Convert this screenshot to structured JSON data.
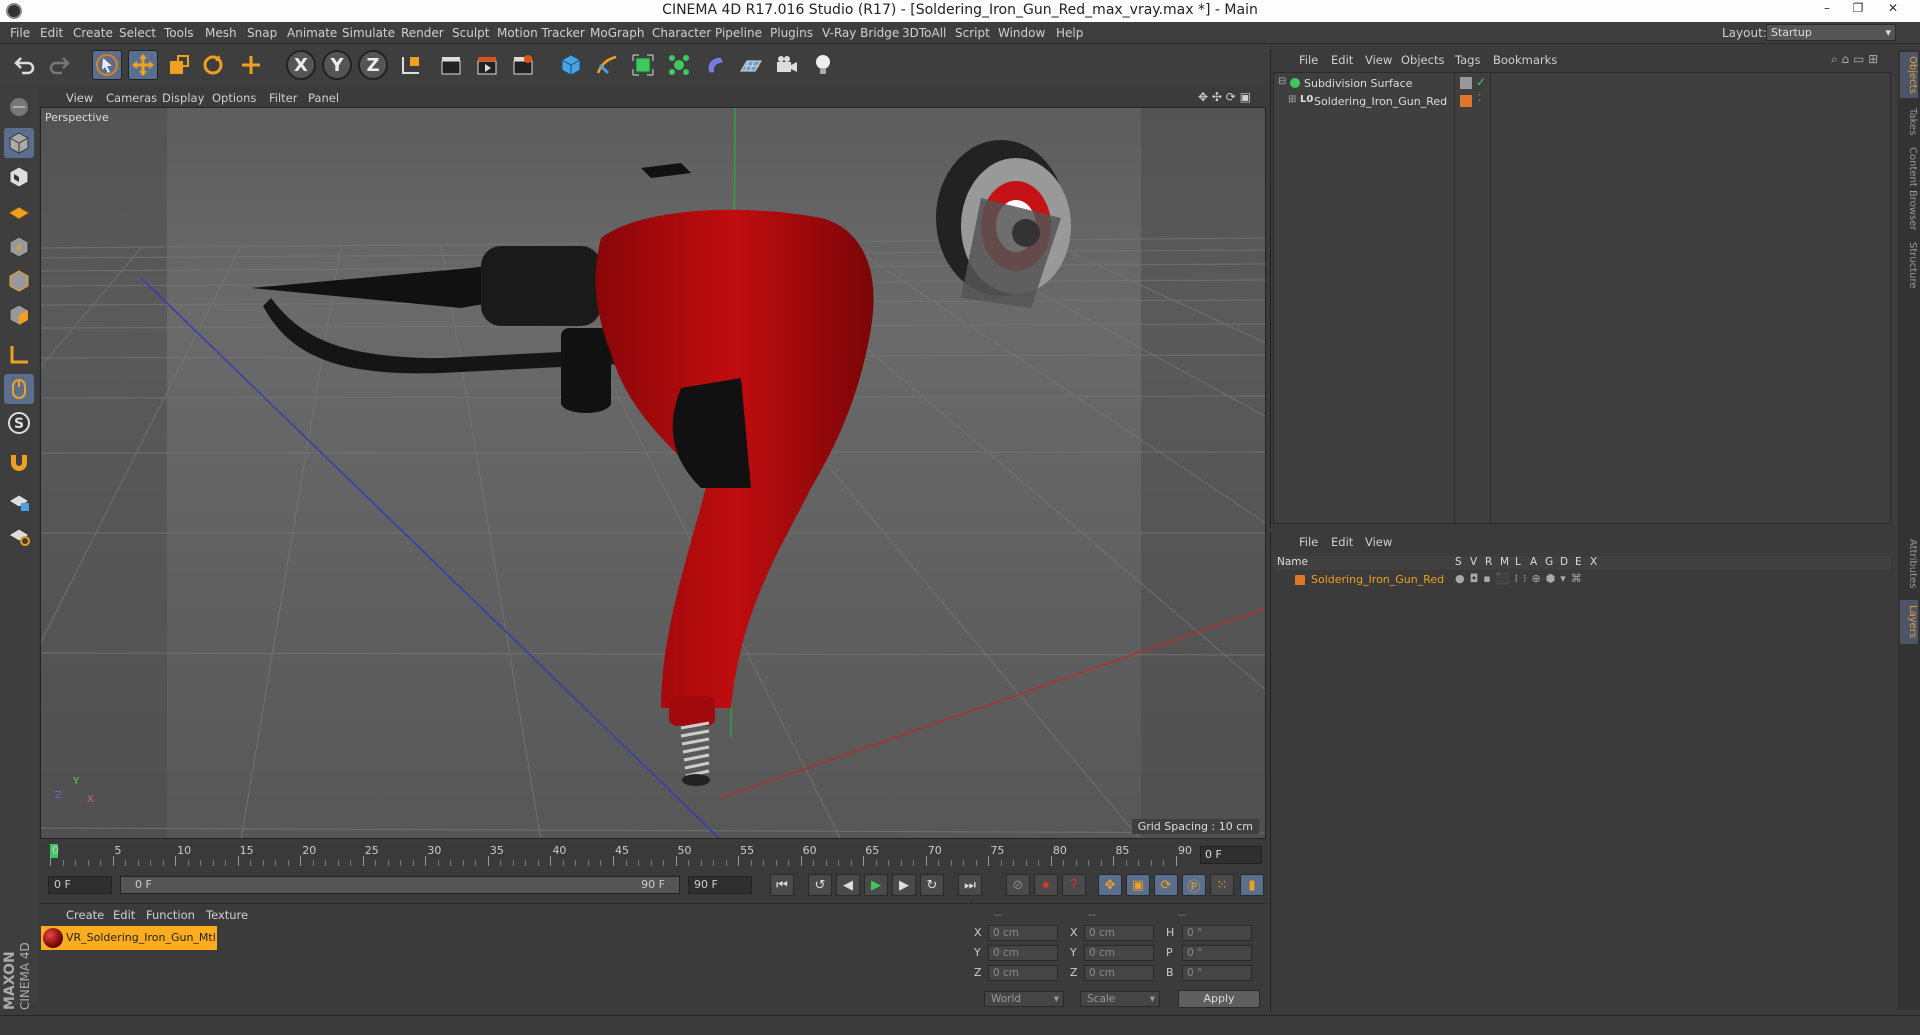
{
  "window": {
    "title": "CINEMA 4D R17.016 Studio (R17) - [Soldering_Iron_Gun_Red_max_vray.max *] - Main",
    "minimize": "–",
    "restore": "❐",
    "close": "✕"
  },
  "menubar": {
    "items": [
      "File",
      "Edit",
      "Create",
      "Select",
      "Tools",
      "Mesh",
      "Snap",
      "Animate",
      "Simulate",
      "Render",
      "Sculpt",
      "Motion Tracker",
      "MoGraph",
      "Character",
      "Pipeline",
      "Plugins",
      "V-Ray Bridge",
      "3DToAll",
      "Script",
      "Window",
      "Help"
    ],
    "layout_label": "Layout:",
    "layout_value": "Startup"
  },
  "toolbar": {
    "axis_x": "X",
    "axis_y": "Y",
    "axis_z": "Z"
  },
  "viewport": {
    "menu": [
      "View",
      "Cameras",
      "Display",
      "Options",
      "Filter",
      "Panel"
    ],
    "label": "Perspective",
    "grid_spacing": "Grid Spacing : 10 cm",
    "axis_y": "Y",
    "axis_x": "X",
    "axis_z": "Z"
  },
  "timeline": {
    "ticks": [
      "0",
      "5",
      "10",
      "15",
      "20",
      "25",
      "30",
      "35",
      "40",
      "45",
      "50",
      "55",
      "60",
      "65",
      "70",
      "75",
      "80",
      "85",
      "90"
    ],
    "frame": "0 F"
  },
  "transport": {
    "start": "0 F",
    "range_start": "0 F",
    "range_end": "90 F",
    "end": "90 F"
  },
  "materials": {
    "menu": [
      "Create",
      "Edit",
      "Function",
      "Texture"
    ],
    "item": "VR_Soldering_Iron_Gun_Mtl"
  },
  "coords": {
    "header": [
      "--",
      "--",
      "--"
    ],
    "rows": [
      {
        "a": "X",
        "av": "0 cm",
        "b": "X",
        "bv": "0 cm",
        "c": "H",
        "cv": "0 °"
      },
      {
        "a": "Y",
        "av": "0 cm",
        "b": "Y",
        "bv": "0 cm",
        "c": "P",
        "cv": "0 °"
      },
      {
        "a": "Z",
        "av": "0 cm",
        "b": "Z",
        "bv": "0 cm",
        "c": "B",
        "cv": "0 °"
      }
    ],
    "world": "World",
    "scale": "Scale",
    "apply": "Apply"
  },
  "objects": {
    "menu": [
      "File",
      "Edit",
      "View",
      "Objects",
      "Tags",
      "Bookmarks"
    ],
    "items": [
      "Subdivision Surface",
      "Soldering_Iron_Gun_Red"
    ],
    "layer_icon": "L0"
  },
  "layers": {
    "menu": [
      "File",
      "Edit",
      "View"
    ],
    "columns": [
      "Name",
      "S",
      "V",
      "R",
      "M",
      "L",
      "A",
      "G",
      "D",
      "E",
      "X"
    ],
    "item": "Soldering_Iron_Gun_Red",
    "colors": {
      "layer": "#e0762a"
    }
  },
  "right_tabs": [
    "Objects",
    "Takes",
    "Content Browser",
    "Structure",
    "Attributes",
    "Layers"
  ],
  "brand": {
    "maxon": "MAXON",
    "c4d": "CINEMA 4D"
  },
  "theme": {
    "accent": "#5a6f8d",
    "material_highlight": "#ffad1f",
    "gun_red": "#b00d10"
  }
}
